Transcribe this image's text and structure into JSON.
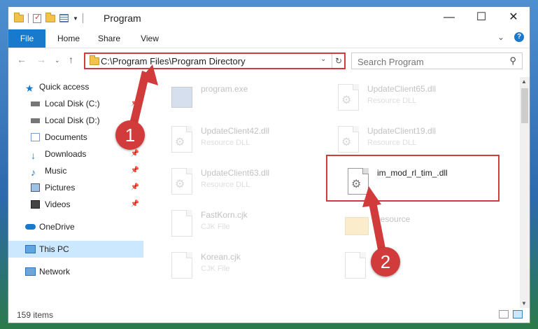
{
  "window": {
    "title": "Program"
  },
  "ribbon": {
    "tabs": [
      "File",
      "Home",
      "Share",
      "View"
    ]
  },
  "address": {
    "path": "C:\\Program Files\\Program Directory"
  },
  "search": {
    "placeholder": "Search Program"
  },
  "sidebar": {
    "items": [
      {
        "label": "Quick access",
        "icon": "star-icon",
        "pinned": false
      },
      {
        "label": "Local Disk (C:)",
        "icon": "drive-icon",
        "pinned": true
      },
      {
        "label": "Local Disk (D:)",
        "icon": "drive-icon",
        "pinned": false
      },
      {
        "label": "Documents",
        "icon": "documents-icon",
        "pinned": true
      },
      {
        "label": "Downloads",
        "icon": "download-icon",
        "pinned": true
      },
      {
        "label": "Music",
        "icon": "music-icon",
        "pinned": true
      },
      {
        "label": "Pictures",
        "icon": "pictures-icon",
        "pinned": true
      },
      {
        "label": "Videos",
        "icon": "videos-icon",
        "pinned": true
      },
      {
        "label": "OneDrive",
        "icon": "cloud-icon",
        "pinned": false
      },
      {
        "label": "This PC",
        "icon": "computer-icon",
        "pinned": false
      },
      {
        "label": "Network",
        "icon": "network-icon",
        "pinned": false
      }
    ]
  },
  "files": {
    "program_exe": {
      "name": "program.exe",
      "type": ""
    },
    "uc65": {
      "name": "UpdateClient65.dll",
      "type": "Resource DLL"
    },
    "uc42": {
      "name": "UpdateClient42.dll",
      "type": "Resource DLL"
    },
    "uc19": {
      "name": "UpdateClient19.dll",
      "type": "Resource DLL"
    },
    "uc63": {
      "name": "UpdateClient63.dll",
      "type": "Resource DLL"
    },
    "target": {
      "name": "im_mod_rl_tim_.dll",
      "type": ""
    },
    "fastkorn": {
      "name": "FastKorn.cjk",
      "type": "CJK File"
    },
    "resource": {
      "name": "Resource",
      "type": ""
    },
    "korean": {
      "name": "Korean.cjk",
      "type": "CJK File"
    }
  },
  "status": {
    "item_count": "159 items"
  },
  "annotations": {
    "step1": "1",
    "step2": "2",
    "color": "#d23b3b"
  }
}
